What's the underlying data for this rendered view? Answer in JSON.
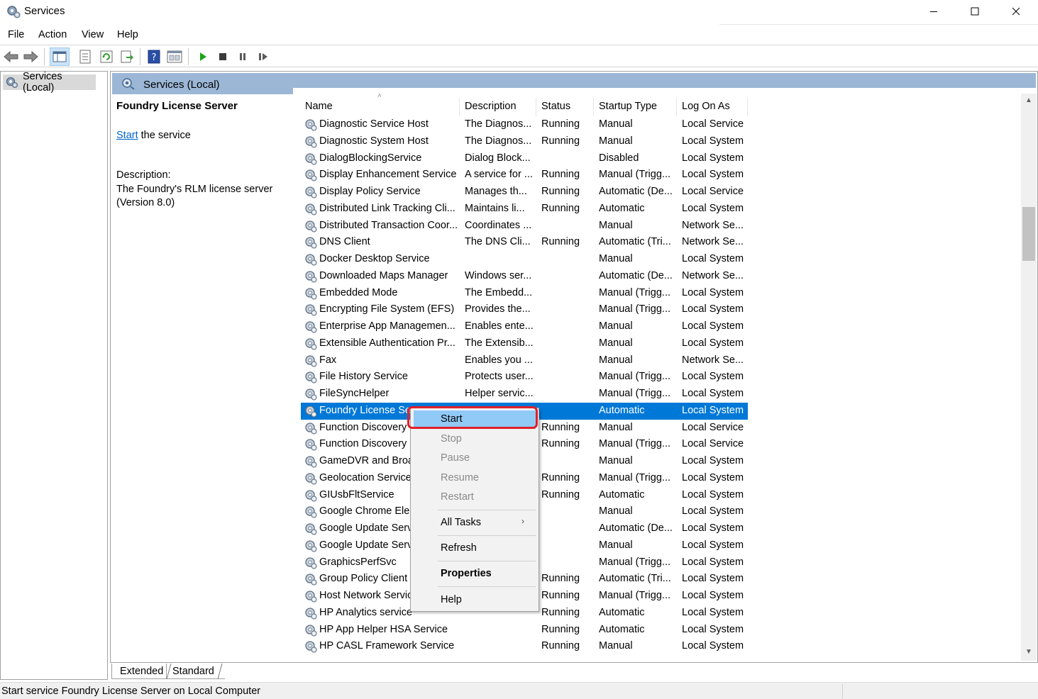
{
  "window": {
    "title": "Services",
    "minimize_glyph": "—",
    "maximize_glyph": "☐",
    "close_glyph": "✕"
  },
  "menu": [
    "File",
    "Action",
    "View",
    "Help"
  ],
  "toolbar": {
    "icons": [
      "back-arrow-icon",
      "forward-arrow-icon",
      "show-console-tree-icon",
      "properties-sheet-icon",
      "refresh-icon",
      "export-list-icon",
      "help-icon",
      "console-view-icon",
      "start-service-icon",
      "stop-service-icon",
      "pause-service-icon",
      "resume-service-icon"
    ]
  },
  "tree": {
    "item": "Services (Local)"
  },
  "panel": {
    "header": "Services (Local)",
    "selected_service": "Foundry License Server",
    "start_link": "Start",
    "start_suffix": " the service",
    "description_label": "Description:",
    "description_text": "The Foundry's RLM license server (Version 8.0)"
  },
  "columns": [
    "Name",
    "Description",
    "Status",
    "Startup Type",
    "Log On As"
  ],
  "rows": [
    [
      "Diagnostic Service Host",
      "The Diagnos...",
      "Running",
      "Manual",
      "Local Service"
    ],
    [
      "Diagnostic System Host",
      "The Diagnos...",
      "Running",
      "Manual",
      "Local System"
    ],
    [
      "DialogBlockingService",
      "Dialog Block...",
      "",
      "Disabled",
      "Local System"
    ],
    [
      "Display Enhancement Service",
      "A service for ...",
      "Running",
      "Manual (Trigg...",
      "Local System"
    ],
    [
      "Display Policy Service",
      "Manages th...",
      "Running",
      "Automatic (De...",
      "Local Service"
    ],
    [
      "Distributed Link Tracking Cli...",
      "Maintains li...",
      "Running",
      "Automatic",
      "Local System"
    ],
    [
      "Distributed Transaction Coor...",
      "Coordinates ...",
      "",
      "Manual",
      "Network Se..."
    ],
    [
      "DNS Client",
      "The DNS Cli...",
      "Running",
      "Automatic (Tri...",
      "Network Se..."
    ],
    [
      "Docker Desktop Service",
      "",
      "",
      "Manual",
      "Local System"
    ],
    [
      "Downloaded Maps Manager",
      "Windows ser...",
      "",
      "Automatic (De...",
      "Network Se..."
    ],
    [
      "Embedded Mode",
      "The Embedd...",
      "",
      "Manual (Trigg...",
      "Local System"
    ],
    [
      "Encrypting File System (EFS)",
      "Provides the...",
      "",
      "Manual (Trigg...",
      "Local System"
    ],
    [
      "Enterprise App Managemen...",
      "Enables ente...",
      "",
      "Manual",
      "Local System"
    ],
    [
      "Extensible Authentication Pr...",
      "The Extensib...",
      "",
      "Manual",
      "Local System"
    ],
    [
      "Fax",
      "Enables you ...",
      "",
      "Manual",
      "Network Se..."
    ],
    [
      "File History Service",
      "Protects user...",
      "",
      "Manual (Trigg...",
      "Local System"
    ],
    [
      "FileSyncHelper",
      "Helper servic...",
      "",
      "Manual (Trigg...",
      "Local System"
    ],
    [
      "Foundry License Se",
      "",
      "",
      "Automatic",
      "Local System"
    ],
    [
      "Function Discovery",
      "",
      "Running",
      "Manual",
      "Local Service"
    ],
    [
      "Function Discovery",
      "",
      "Running",
      "Manual (Trigg...",
      "Local Service"
    ],
    [
      "GameDVR and Broa",
      "",
      "",
      "Manual",
      "Local System"
    ],
    [
      "Geolocation Service",
      "",
      "Running",
      "Manual (Trigg...",
      "Local System"
    ],
    [
      "GIUsbFltService",
      "",
      "Running",
      "Automatic",
      "Local System"
    ],
    [
      "Google Chrome Ele",
      "",
      "",
      "Manual",
      "Local System"
    ],
    [
      "Google Update Serv",
      "",
      "",
      "Automatic (De...",
      "Local System"
    ],
    [
      "Google Update Serv",
      "",
      "",
      "Manual",
      "Local System"
    ],
    [
      "GraphicsPerfSvc",
      "",
      "",
      "Manual (Trigg...",
      "Local System"
    ],
    [
      "Group Policy Client",
      "",
      "Running",
      "Automatic (Tri...",
      "Local System"
    ],
    [
      "Host Network Servic",
      "",
      "Running",
      "Manual (Trigg...",
      "Local System"
    ],
    [
      "HP Analytics service",
      "",
      "Running",
      "Automatic",
      "Local System"
    ],
    [
      "HP App Helper HSA Service",
      "",
      "Running",
      "Automatic",
      "Local System"
    ],
    [
      "HP CASL Framework Service",
      "",
      "Running",
      "Manual",
      "Local System"
    ]
  ],
  "selected_row_index": 17,
  "context_menu": {
    "items": [
      "Start",
      "Stop",
      "Pause",
      "Resume",
      "Restart",
      "All Tasks",
      "Refresh",
      "Properties",
      "Help"
    ],
    "submenu_arrow": "›"
  },
  "tabs": [
    "Extended",
    "Standard"
  ],
  "status_bar": "Start service Foundry License Server on Local Computer",
  "colors": {
    "selection": "#0078d7",
    "panel_header": "#9cb7d6",
    "menu_hot": "#91c9f7",
    "annotation_red": "#e0202a"
  }
}
